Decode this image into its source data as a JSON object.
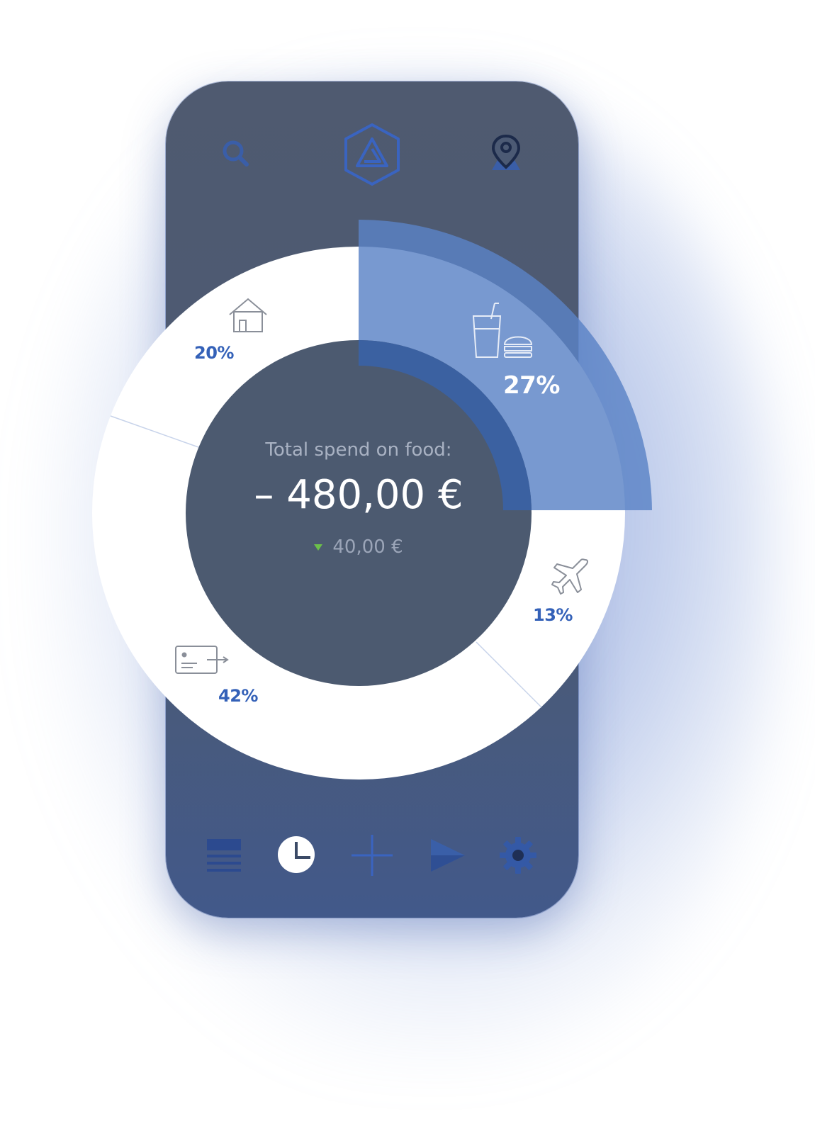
{
  "header": {
    "icons": [
      "search-icon",
      "logo-icon",
      "location-pin-icon"
    ]
  },
  "summary": {
    "label": "Total spend on food:",
    "amount": "– 480,00 €",
    "delta": "40,00 €",
    "delta_direction": "down",
    "delta_color": "#6cc04a"
  },
  "chart_data": {
    "type": "pie",
    "segments": [
      {
        "icon": "food-drink-icon",
        "label": "27%",
        "value": 27,
        "highlighted": true
      },
      {
        "icon": "airplane-icon",
        "label": "13%",
        "value": 13
      },
      {
        "icon": "card-transfer-icon",
        "label": "42%",
        "value": 42
      },
      {
        "icon": "house-icon",
        "label": "20%",
        "value": 20
      }
    ]
  },
  "bottom_nav": {
    "items": [
      "list-icon",
      "pie-chart-icon",
      "plus-icon",
      "send-icon",
      "settings-icon"
    ],
    "active": "pie-chart-icon"
  },
  "colors": {
    "phone": "#4c5a74",
    "accent": "#3461b8",
    "highlight": "#6a8fcc"
  }
}
